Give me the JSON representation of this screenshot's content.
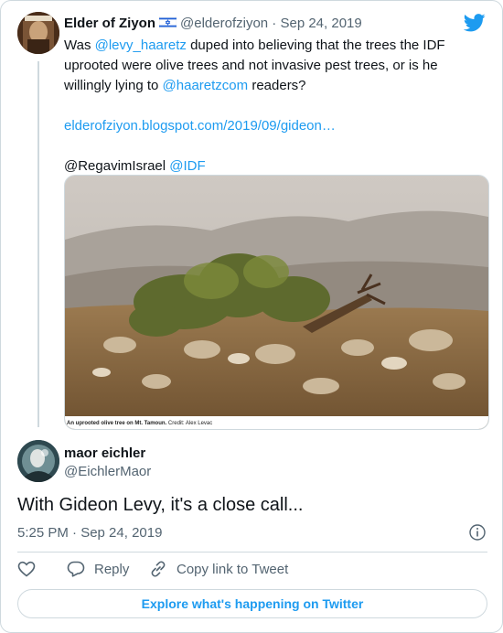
{
  "quoted_tweet": {
    "display_name": "Elder of Ziyon",
    "handle": "@elderofziyon",
    "separator": "·",
    "date": "Sep 24, 2019",
    "text_parts": {
      "t1": "Was ",
      "mention1": "@levy_haaretz",
      "t2": " duped into believing that the trees the IDF uprooted were olive trees and not invasive pest trees, or is he willingly lying to ",
      "mention2": "@haaretzcom",
      "t3": " readers?",
      "url": "elderofziyon.blogspot.com/2019/09/gideon…",
      "mention3_plain": "@RegavimIsrael",
      "mention4": "@IDF"
    },
    "image_caption": {
      "title": "An uprooted olive tree on Mt. Tamoun.",
      "credit": "Credit: Alex Levac"
    }
  },
  "reply_tweet": {
    "display_name": "maor eichler",
    "handle": "@EichlerMaor",
    "text": "With Gideon Levy, it's a close call...",
    "timestamp": "5:25 PM · Sep 24, 2019"
  },
  "actions": {
    "reply_label": "Reply",
    "copy_link_label": "Copy link to Tweet"
  },
  "explore_label": "Explore what's happening on Twitter",
  "colors": {
    "accent": "#1d9bf0",
    "text": "#0f1419",
    "muted": "#536471",
    "border": "#cfd9de"
  },
  "icons": {
    "logo": "twitter-bird-icon",
    "flag": "israel-flag-icon",
    "info": "info-icon",
    "like": "heart-icon",
    "reply": "reply-bubble-icon",
    "copy": "link-icon"
  }
}
